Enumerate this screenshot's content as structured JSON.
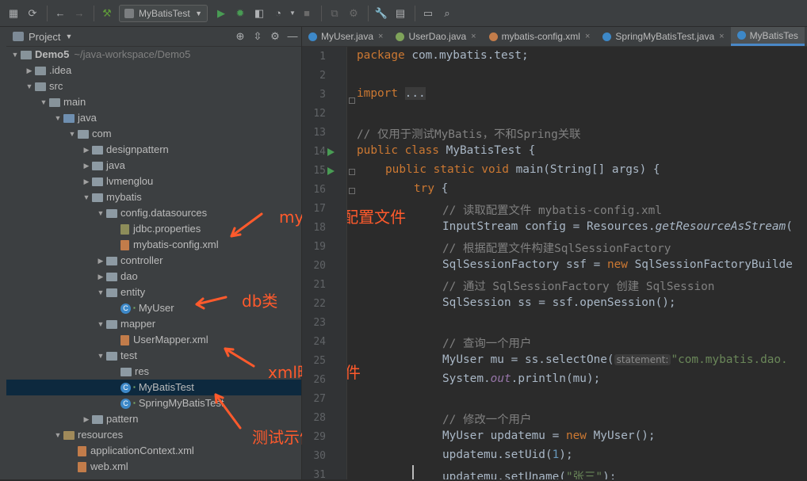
{
  "toolbar": {
    "run_config": "MyBatisTest",
    "icons": [
      "save-icon",
      "sync-icon",
      "back-icon",
      "forward-icon",
      "build-icon",
      "run-icon",
      "debug-icon",
      "coverage-icon",
      "profile-icon",
      "stop-icon",
      "attach-icon",
      "settings-icon",
      "project-structure-icon",
      "terminal-icon",
      "search-icon"
    ]
  },
  "project_panel": {
    "title": "Project",
    "tree": [
      {
        "label": "Demo5",
        "hint": "~/java-workspace/Demo5",
        "depth": 0,
        "open": true,
        "kind": "module"
      },
      {
        "label": ".idea",
        "depth": 1,
        "open": false,
        "kind": "folder"
      },
      {
        "label": "src",
        "depth": 1,
        "open": true,
        "kind": "folder"
      },
      {
        "label": "main",
        "depth": 2,
        "open": true,
        "kind": "folder"
      },
      {
        "label": "java",
        "depth": 3,
        "open": true,
        "kind": "src"
      },
      {
        "label": "com",
        "depth": 4,
        "open": true,
        "kind": "pkg"
      },
      {
        "label": "designpattern",
        "depth": 5,
        "open": false,
        "kind": "pkg"
      },
      {
        "label": "java",
        "depth": 5,
        "open": false,
        "kind": "pkg"
      },
      {
        "label": "lvmenglou",
        "depth": 5,
        "open": false,
        "kind": "pkg"
      },
      {
        "label": "mybatis",
        "depth": 5,
        "open": true,
        "kind": "pkg"
      },
      {
        "label": "config.datasources",
        "depth": 6,
        "open": true,
        "kind": "pkg"
      },
      {
        "label": "jdbc.properties",
        "depth": 7,
        "kind": "prop"
      },
      {
        "label": "mybatis-config.xml",
        "depth": 7,
        "kind": "xml"
      },
      {
        "label": "controller",
        "depth": 6,
        "open": false,
        "kind": "pkg"
      },
      {
        "label": "dao",
        "depth": 6,
        "open": false,
        "kind": "pkg"
      },
      {
        "label": "entity",
        "depth": 6,
        "open": true,
        "kind": "pkg"
      },
      {
        "label": "MyUser",
        "depth": 7,
        "kind": "class"
      },
      {
        "label": "mapper",
        "depth": 6,
        "open": true,
        "kind": "pkg"
      },
      {
        "label": "UserMapper.xml",
        "depth": 7,
        "kind": "xml"
      },
      {
        "label": "test",
        "depth": 6,
        "open": true,
        "kind": "pkg"
      },
      {
        "label": "res",
        "depth": 7,
        "kind": "pkg"
      },
      {
        "label": "MyBatisTest",
        "depth": 7,
        "kind": "test",
        "selected": true
      },
      {
        "label": "SpringMyBatisTest",
        "depth": 7,
        "kind": "test"
      },
      {
        "label": "pattern",
        "depth": 5,
        "open": false,
        "kind": "pkg"
      },
      {
        "label": "resources",
        "depth": 3,
        "open": true,
        "kind": "res"
      },
      {
        "label": "applicationContext.xml",
        "depth": 4,
        "kind": "xml"
      },
      {
        "label": "web.xml",
        "depth": 4,
        "kind": "xml"
      }
    ]
  },
  "annotations": {
    "config": "mybatis配置文件",
    "db": "db类",
    "xml": "xml映射文件",
    "test": "测试示例"
  },
  "tabs": [
    {
      "label": "MyUser.java",
      "color": "#3d88c8"
    },
    {
      "label": "UserDao.java",
      "color": "#7fa35a"
    },
    {
      "label": "mybatis-config.xml",
      "color": "#c27c4a"
    },
    {
      "label": "SpringMyBatisTest.java",
      "color": "#3d88c8"
    },
    {
      "label": "MyBatisTes",
      "color": "#3d88c8",
      "active": true
    }
  ],
  "editor": {
    "line_numbers": [
      "1",
      "2",
      "3",
      "12",
      "13",
      "14",
      "15",
      "16",
      "17",
      "18",
      "19",
      "20",
      "21",
      "22",
      "23",
      "24",
      "25",
      "26",
      "27",
      "28",
      "29",
      "30",
      "31"
    ],
    "lines": {
      "l1_kw": "package",
      "l1_rest": " com.mybatis.test;",
      "l3_kw": "import",
      "l3_fold": "...",
      "l13": "// 仅用于测试MyBatis，不和Spring关联",
      "l14_kw": "public class",
      "l14_rest": " MyBatisTest {",
      "l15_kw": "public static void",
      "l15_rest": " main(String[] args) {",
      "l16_kw": "try",
      "l16_rest": " {",
      "l17": "// 读取配置文件 mybatis-config.xml",
      "l18_a": "InputStream config = Resources.",
      "l18_it": "getResourceAsStream",
      "l18_b": "(",
      "l19": "// 根据配置文件构建SqlSessionFactory",
      "l20_a": "SqlSessionFactory ssf = ",
      "l20_kw": "new",
      "l20_b": " SqlSessionFactoryBuilde",
      "l21": "// 通过 SqlSessionFactory 创建 SqlSession",
      "l22": "SqlSession ss = ssf.openSession();",
      "l24": "// 查询一个用户",
      "l25_a": "MyUser mu = ss.selectOne(",
      "l25_hint": "statement:",
      "l25_str": "\"com.mybatis.dao.",
      "l26_a": "System.",
      "l26_fld": "out",
      "l26_b": ".println(mu);",
      "l28": "// 修改一个用户",
      "l29_a": "MyUser updatemu = ",
      "l29_kw": "new",
      "l29_b": " MyUser();",
      "l30_a": "updatemu.setUid(",
      "l30_num": "1",
      "l30_b": ");",
      "l31_a": "updatemu.setUname(",
      "l31_str": "\"张三\"",
      "l31_b": ");"
    }
  }
}
